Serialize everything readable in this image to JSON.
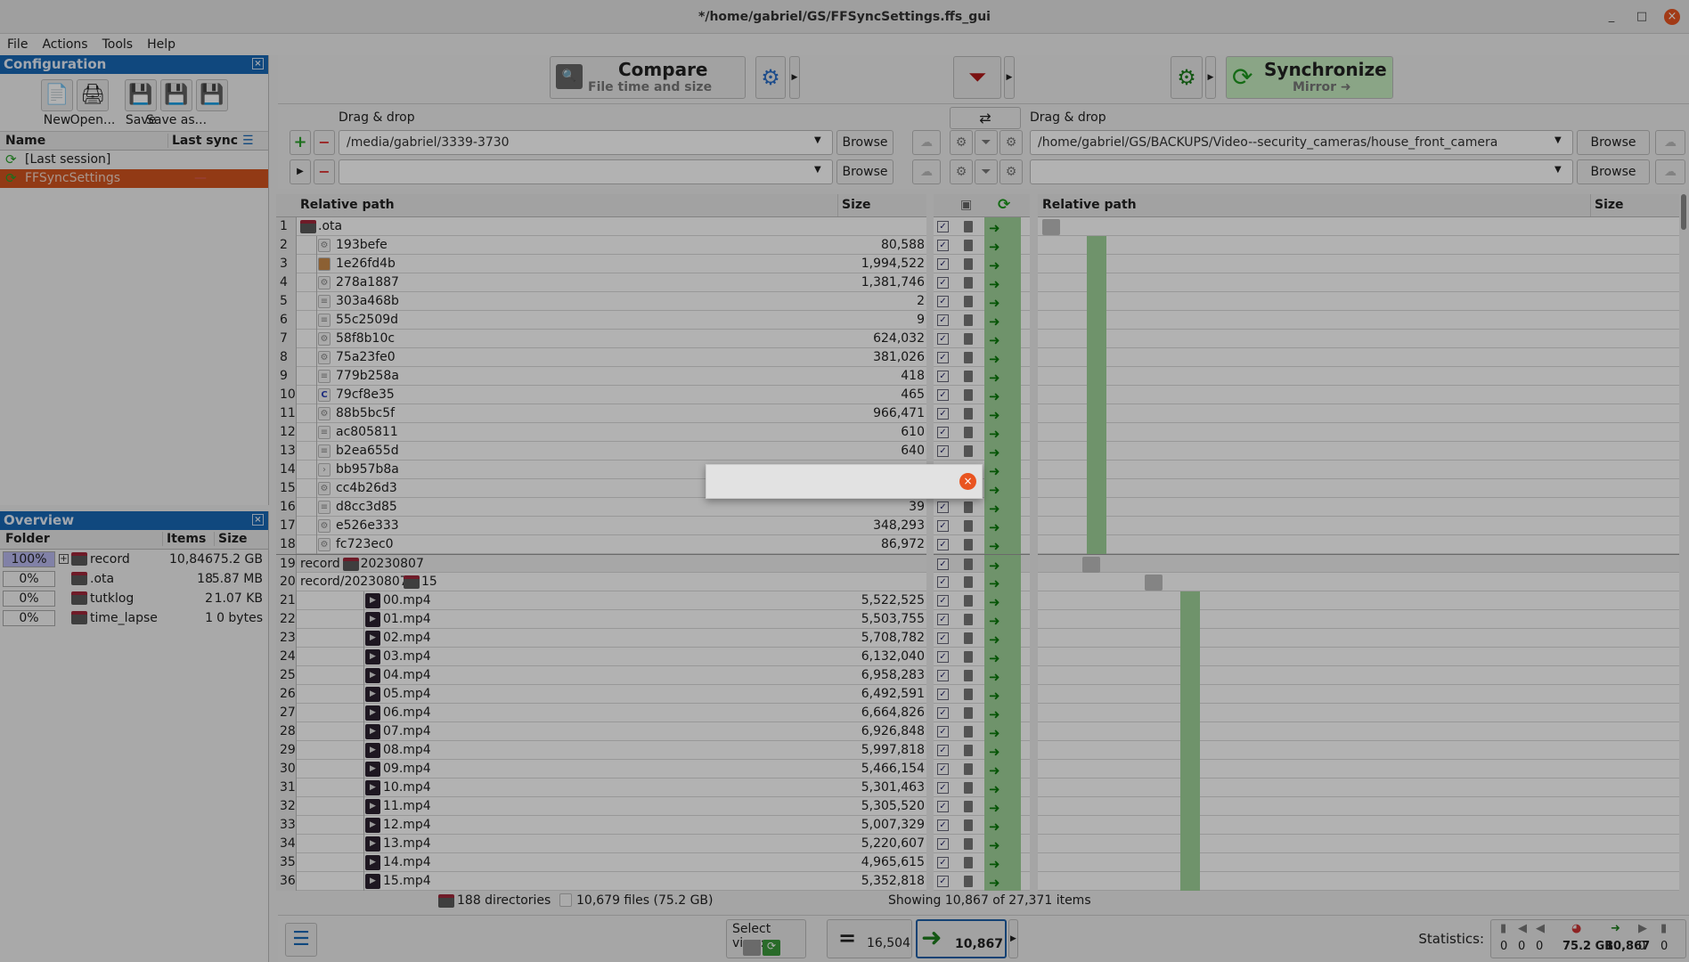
{
  "window": {
    "title": "*/home/gabriel/GS/FFSyncSettings.ffs_gui",
    "minimize": "_",
    "maximize": "□",
    "close": "×"
  },
  "menu": [
    "File",
    "Actions",
    "Tools",
    "Help"
  ],
  "config": {
    "title": "Configuration",
    "close": "×",
    "buttons": [
      {
        "label": "New",
        "icon": "new-file-icon"
      },
      {
        "label": "Open...",
        "icon": "open-icon"
      },
      {
        "label": "Save",
        "icon": "save-icon"
      },
      {
        "label": "Save as...",
        "icon": "save-as-icon"
      },
      {
        "label": "",
        "icon": "save-as-batch-icon"
      }
    ],
    "columns": {
      "name": "Name",
      "last_sync": "Last sync"
    },
    "items": [
      {
        "name": "[Last session]",
        "last_sync": "",
        "selected": false
      },
      {
        "name": "FFSyncSettings",
        "last_sync": "—",
        "selected": true
      }
    ]
  },
  "overview": {
    "title": "Overview",
    "close": "×",
    "columns": {
      "folder": "Folder",
      "items": "Items",
      "size": "Size"
    },
    "rows": [
      {
        "pct": "100%",
        "fill": 1.0,
        "expand": "+",
        "name": "record",
        "items": "10,846",
        "size": "75.2 GB"
      },
      {
        "pct": "0%",
        "fill": 0,
        "name": ".ota",
        "items": "18",
        "size": "5.87 MB"
      },
      {
        "pct": "0%",
        "fill": 0,
        "name": "tutklog",
        "items": "2",
        "size": "1.07 KB"
      },
      {
        "pct": "0%",
        "fill": 0,
        "name": "time_lapse",
        "items": "1",
        "size": "0 bytes"
      }
    ]
  },
  "toolbar": {
    "compare": "Compare",
    "compare_sub": "File time and size",
    "synchronize": "Synchronize",
    "sync_sub": "Mirror ➜"
  },
  "pairs": {
    "drag_drop": "Drag & drop",
    "browse": "Browse",
    "left": [
      "/media/gabriel/3339-3730",
      ""
    ],
    "right": [
      "/home/gabriel/GS/BACKUPS/Video--security_cameras/house_front_camera",
      ""
    ]
  },
  "grid": {
    "rel_path": "Relative path",
    "size": "Size",
    "rows": [
      {
        "n": "1",
        "parent": "",
        "name": ".ota",
        "size": "",
        "icon": "folder",
        "level": 0
      },
      {
        "n": "2",
        "parent": "",
        "name": "193befe",
        "size": "80,588",
        "icon": "gear",
        "level": 1
      },
      {
        "n": "3",
        "parent": "",
        "name": "1e26fd4b",
        "size": "1,994,522",
        "icon": "archive",
        "level": 1
      },
      {
        "n": "4",
        "parent": "",
        "name": "278a1887",
        "size": "1,381,746",
        "icon": "gear",
        "level": 1
      },
      {
        "n": "5",
        "parent": "",
        "name": "303a468b",
        "size": "2",
        "icon": "text",
        "level": 1
      },
      {
        "n": "6",
        "parent": "",
        "name": "55c2509d",
        "size": "9",
        "icon": "text",
        "level": 1
      },
      {
        "n": "7",
        "parent": "",
        "name": "58f8b10c",
        "size": "624,032",
        "icon": "gear",
        "level": 1
      },
      {
        "n": "8",
        "parent": "",
        "name": "75a23fe0",
        "size": "381,026",
        "icon": "gear",
        "level": 1
      },
      {
        "n": "9",
        "parent": "",
        "name": "779b258a",
        "size": "418",
        "icon": "text",
        "level": 1
      },
      {
        "n": "10",
        "parent": "",
        "name": "79cf8e35",
        "size": "465",
        "icon": "c",
        "level": 1
      },
      {
        "n": "11",
        "parent": "",
        "name": "88b5bc5f",
        "size": "966,471",
        "icon": "gear",
        "level": 1
      },
      {
        "n": "12",
        "parent": "",
        "name": "ac805811",
        "size": "610",
        "icon": "text",
        "level": 1
      },
      {
        "n": "13",
        "parent": "",
        "name": "b2ea655d",
        "size": "640",
        "icon": "text",
        "level": 1
      },
      {
        "n": "14",
        "parent": "",
        "name": "bb957b8a",
        "size": "",
        "icon": "script",
        "level": 1
      },
      {
        "n": "15",
        "parent": "",
        "name": "cc4b26d3",
        "size": "",
        "icon": "gear",
        "level": 1
      },
      {
        "n": "16",
        "parent": "",
        "name": "d8cc3d85",
        "size": "39",
        "icon": "text",
        "level": 1
      },
      {
        "n": "17",
        "parent": "",
        "name": "e526e333",
        "size": "348,293",
        "icon": "gear",
        "level": 1
      },
      {
        "n": "18",
        "parent": "",
        "name": "fc723ec0",
        "size": "86,972",
        "icon": "gear",
        "level": 1
      },
      {
        "n": "19",
        "parent": "record",
        "name": "20230807",
        "size": "",
        "icon": "folder",
        "level": 0
      },
      {
        "n": "20",
        "parent": "record/20230807",
        "name": "15",
        "size": "",
        "icon": "folder",
        "level": 0
      },
      {
        "n": "21",
        "parent": "",
        "name": "00.mp4",
        "size": "5,522,525",
        "icon": "video",
        "level": 2
      },
      {
        "n": "22",
        "parent": "",
        "name": "01.mp4",
        "size": "5,503,755",
        "icon": "video",
        "level": 2
      },
      {
        "n": "23",
        "parent": "",
        "name": "02.mp4",
        "size": "5,708,782",
        "icon": "video",
        "level": 2
      },
      {
        "n": "24",
        "parent": "",
        "name": "03.mp4",
        "size": "6,132,040",
        "icon": "video",
        "level": 2
      },
      {
        "n": "25",
        "parent": "",
        "name": "04.mp4",
        "size": "6,958,283",
        "icon": "video",
        "level": 2
      },
      {
        "n": "26",
        "parent": "",
        "name": "05.mp4",
        "size": "6,492,591",
        "icon": "video",
        "level": 2
      },
      {
        "n": "27",
        "parent": "",
        "name": "06.mp4",
        "size": "6,664,826",
        "icon": "video",
        "level": 2
      },
      {
        "n": "28",
        "parent": "",
        "name": "07.mp4",
        "size": "6,926,848",
        "icon": "video",
        "level": 2
      },
      {
        "n": "29",
        "parent": "",
        "name": "08.mp4",
        "size": "5,997,818",
        "icon": "video",
        "level": 2
      },
      {
        "n": "30",
        "parent": "",
        "name": "09.mp4",
        "size": "5,466,154",
        "icon": "video",
        "level": 2
      },
      {
        "n": "31",
        "parent": "",
        "name": "10.mp4",
        "size": "5,301,463",
        "icon": "video",
        "level": 2
      },
      {
        "n": "32",
        "parent": "",
        "name": "11.mp4",
        "size": "5,305,520",
        "icon": "video",
        "level": 2
      },
      {
        "n": "33",
        "parent": "",
        "name": "12.mp4",
        "size": "5,007,329",
        "icon": "video",
        "level": 2
      },
      {
        "n": "34",
        "parent": "",
        "name": "13.mp4",
        "size": "5,220,607",
        "icon": "video",
        "level": 2
      },
      {
        "n": "35",
        "parent": "",
        "name": "14.mp4",
        "size": "4,965,615",
        "icon": "video",
        "level": 2
      },
      {
        "n": "36",
        "parent": "",
        "name": "15.mp4",
        "size": "5,352,818",
        "icon": "video",
        "level": 2
      }
    ]
  },
  "status": {
    "directories": "188 directories",
    "files": "10,679 files (75.2 GB)",
    "showing": "Showing 10,867 of 27,371 items"
  },
  "bottom": {
    "select_view": "Select view:",
    "equal_count": "16,504",
    "create_count": "10,867",
    "statistics": "Statistics:",
    "stats": [
      "0",
      "0",
      "0",
      "75.2 GB",
      "10,867",
      "0",
      "0"
    ]
  },
  "colors": {
    "accent": "#1767b5",
    "selected": "#d2531f",
    "sync_green": "#9fd39a",
    "create_green": "#0a7a0a",
    "close_orange": "#e95420"
  }
}
